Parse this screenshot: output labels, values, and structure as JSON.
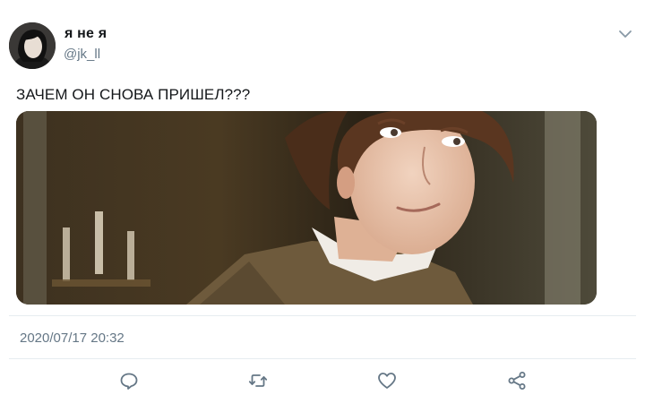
{
  "tweet": {
    "author": {
      "display_name": "я не я",
      "handle": "@jk_ll"
    },
    "text": "ЗАЧЕМ ОН СНОВА ПРИШЕЛ???",
    "timestamp": "2020/07/17 20:32"
  },
  "icons": {
    "menu": "chevron-down-icon",
    "reply": "reply-icon",
    "retweet": "retweet-icon",
    "like": "heart-icon",
    "share": "share-icon"
  },
  "colors": {
    "text_primary": "#14171a",
    "text_secondary": "#657786",
    "icon": "#657786",
    "divider": "#e6ecf0"
  }
}
